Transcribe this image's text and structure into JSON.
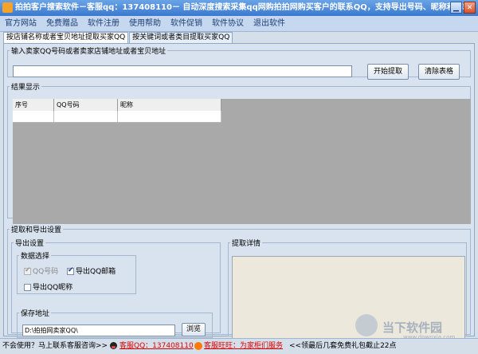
{
  "window": {
    "title": "拍拍客户搜索软件－客服qq：137408110－ 自动深度搜索采集qq网购拍拍网购买客户的联系QQ，支持导出号码、昵称和邮箱"
  },
  "menu": [
    "官方网站",
    "免费赠品",
    "软件注册",
    "使用帮助",
    "软件促销",
    "软件协议",
    "退出软件"
  ],
  "tabs": [
    {
      "label": "按店铺名称或者宝贝地址提取买家QQ",
      "active": true
    },
    {
      "label": "按关键词或者类目提取买家QQ",
      "active": false
    }
  ],
  "input_section": {
    "legend": "输入卖家QQ号码或者卖家店铺地址或者宝贝地址",
    "value": "",
    "start_button": "开始提取",
    "clear_button": "清除表格"
  },
  "results": {
    "legend": "结果显示",
    "columns": [
      "序号",
      "QQ号码",
      "昵称"
    ]
  },
  "settings": {
    "legend": "提取和导出设置",
    "export_legend": "导出设置",
    "data_select_legend": "数据选择",
    "options": [
      {
        "label": "QQ号码",
        "checked": true,
        "disabled": true
      },
      {
        "label": "导出QQ邮箱",
        "checked": true,
        "disabled": false
      },
      {
        "label": "导出QQ昵称",
        "checked": false,
        "disabled": false
      }
    ],
    "save_legend": "保存地址",
    "save_path": "D:\\拍拍网卖家QQ\\",
    "browse_button": "浏览"
  },
  "details": {
    "legend": "提取详情"
  },
  "status": {
    "help_text": "不会使用？马上联系客服咨询>>",
    "qq_link": "客服QQ：137408110",
    "wangwang_link": "客服旺旺：为家柜们服务",
    "promo": "<<领最后几套免费礼包截止22点"
  },
  "watermark": {
    "main": "当下软件园",
    "sub": "www.downxia.com"
  }
}
